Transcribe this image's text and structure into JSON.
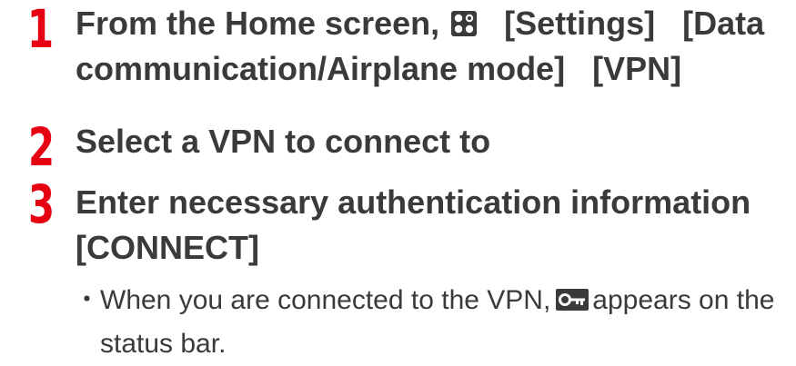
{
  "steps": [
    {
      "number": "1",
      "line1_a": "From the Home screen,",
      "line1_b": "[Settings]",
      "line1_c": "[Data",
      "line2_a": "communication/Airplane mode]",
      "line2_b": "[VPN]",
      "icon": "apps-grid-icon"
    },
    {
      "number": "2",
      "line1": "Select a VPN to connect to"
    },
    {
      "number": "3",
      "line1": "Enter necessary authentication information",
      "line2": "[CONNECT]"
    }
  ],
  "note": {
    "bullet": "･",
    "text_before": "When you are connected to the VPN,",
    "text_after": "appears on the",
    "line2": "status bar.",
    "icon": "vpn-key-icon"
  },
  "colors": {
    "accent": "#e60012",
    "text": "#3a3a3a"
  }
}
